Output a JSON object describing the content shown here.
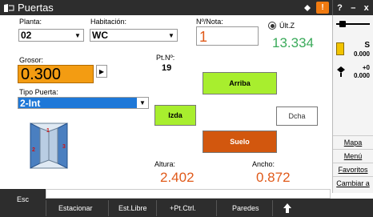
{
  "title_bar": {
    "title": "Puertas",
    "right_help": "?",
    "right_minus": "–",
    "right_close": "x"
  },
  "form": {
    "planta_label": "Planta:",
    "planta_value": "02",
    "habitacion_label": "Habitación:",
    "habitacion_value": "WC",
    "nota_label": "Nº/Nota:",
    "nota_value": "1",
    "ult_z_label": "Últ.Z",
    "ult_z_value": "13.334",
    "grosor_label": "Grosor:",
    "grosor_value": "0.300",
    "ptn_label": "Pt.Nº:",
    "ptn_value": "19",
    "tipo_label": "Tipo Puerta:",
    "tipo_value": "2-Int",
    "altura_label": "Altura:",
    "altura_value": "2.402",
    "ancho_label": "Ancho:",
    "ancho_value": "0.872"
  },
  "buttons": {
    "arriba": "Arriba",
    "izda": "Izda",
    "dcha": "Dcha",
    "suelo": "Suelo"
  },
  "right_panel": {
    "s_label": "S",
    "s_value": "0.000",
    "t_label": "+0",
    "t_value": "0.000",
    "menu": [
      "Mapa",
      "Menú",
      "Favoritos",
      "Cambiar a"
    ]
  },
  "door_markers": [
    "1",
    "2",
    "3"
  ],
  "bottom_bar": {
    "esc": "Esc",
    "items": [
      "Estacionar",
      "Est.Libre",
      "+Pt.Ctrl.",
      "Paredes"
    ]
  },
  "colors": {
    "accent_orange": "#f39c12",
    "green_button": "#a8ee2e",
    "suelo_button": "#d2570e",
    "selection_blue": "#1e78d8",
    "value_green": "#3aaa5a",
    "value_orange": "#e05a1a"
  }
}
